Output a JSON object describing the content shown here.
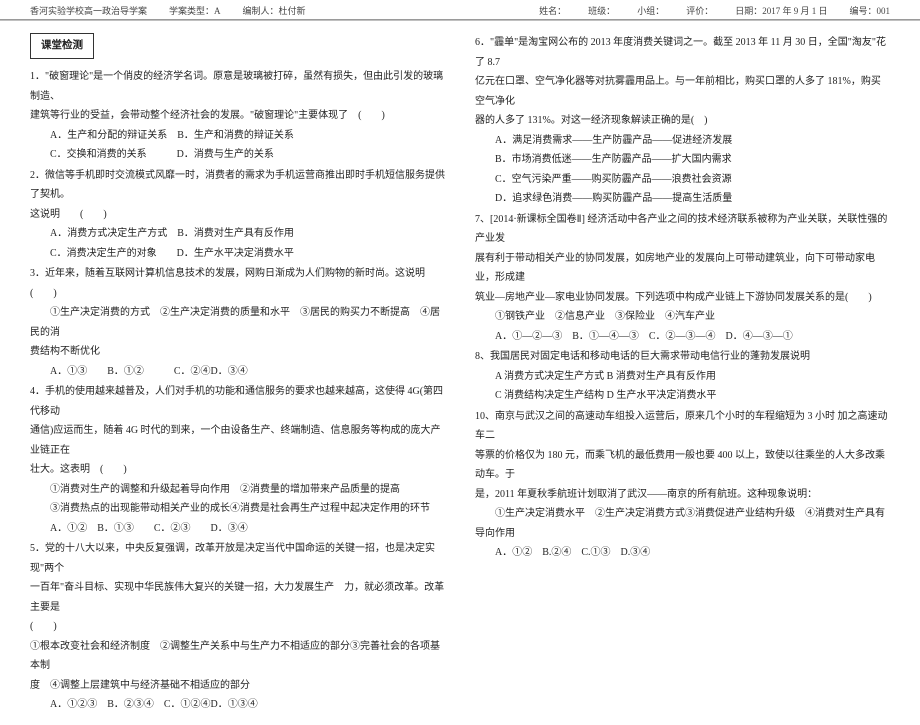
{
  "header": {
    "school": "香河实验学校高一政治导学案",
    "type_label": "学案类型：A",
    "author": "编制人：杜付新",
    "name_label": "姓名：",
    "class_label": "班级：",
    "group_label": "小组：",
    "eval_label": "评价：",
    "date_label": "日期：2017 年 9 月 1 日",
    "id_label": "编号：001"
  },
  "section_title": "课堂检测",
  "left": {
    "q1_l1": "1．\"破窗理论\"是一个俏皮的经济学名词。原意是玻璃被打碎，虽然有损失，但由此引发的玻璃制造、",
    "q1_l2": "建筑等行业的受益，会带动整个经济社会的发展。\"破窗理论\"主要体现了　(　　)",
    "q1_opts": "A．生产和分配的辩证关系　B．生产和消费的辩证关系",
    "q1_opts2": "C．交换和消费的关系　　　D．消费与生产的关系",
    "q2_l1": "2．微信等手机即时交流模式风靡一时，消费者的需求为手机运营商推出即时手机短信服务提供了契机。",
    "q2_l2": "这说明　　(　　)",
    "q2_opts": "A．消费方式决定生产方式　B．消费对生产具有反作用",
    "q2_opts2": "C．消费决定生产的对象　　D．生产水平决定消费水平",
    "q3_l1": "3．近年来，随着互联网计算机信息技术的发展，网购日渐成为人们购物的新时尚。这说明　(　　)",
    "q3_items": "　　①生产决定消费的方式　②生产决定消费的质量和水平　③居民的购买力不断提高　④居民的消",
    "q3_items2": "费结构不断优化",
    "q3_opts": "A．①③　　B．①②　　　C．②④D．③④",
    "q4_l1": "4．手机的使用越来越普及，人们对手机的功能和通信服务的要求也越来越高，这使得 4G(第四代移动",
    "q4_l2": "通信)应运而生，随着 4G 时代的到来，一个由设备生产、终端制造、信息服务等构成的庞大产业链正在",
    "q4_l3": "壮大。这表明　(　　)",
    "q4_items1": "　　①消费对生产的调整和升级起着导向作用　②消费量的增加带来产品质量的提高",
    "q4_items2": "　　③消费热点的出现能带动相关产业的成长④消费是社会再生产过程中起决定作用的环节",
    "q4_opts": "A．①②　B．①③　　C．②③　　D．③④",
    "q5_l1": "5．党的十八大以来，中央反复强调，改革开放是决定当代中国命运的关键一招，也是决定实现\"两个",
    "q5_l2": "一百年\"奋斗目标、实现中华民族伟大复兴的关键一招，大力发展生产　力，就必须改革。改革主要是",
    "q5_l3": "(　　)",
    "q5_items": "①根本改变社会和经济制度　②调整生产关系中与生产力不相适应的部分③完善社会的各项基本制",
    "q5_items2": "度　④调整上层建筑中与经济基础不相适应的部分",
    "q5_opts": "A．①②③　B．②③④　C．①②④D．①③④"
  },
  "right": {
    "q6_l1": "6．\"霾单\"是淘宝网公布的 2013 年度消费关键词之一。截至 2013 年 11 月 30 日，全国\"淘友\"花了 8.7",
    "q6_l2": "亿元在口罩、空气净化器等对抗雾霾用品上。与一年前相比，购买口罩的人多了 181%，购买空气净化",
    "q6_l3": "器的人多了 131%。对这一经济现象解读正确的是(　)",
    "q6_a": "A．满足消费需求——生产防霾产品——促进经济发展",
    "q6_b": "B．市场消费低迷——生产防霾产品——扩大国内需求",
    "q6_c": "C．空气污染严重——购买防霾产品——浪费社会资源",
    "q6_d": "D．追求绿色消费——购买防霾产品——提高生活质量",
    "q7_l1": "7、[2014·新课标全国卷Ⅱ] 经济活动中各产业之间的技术经济联系被称为产业关联，关联性强的产业发",
    "q7_l2": "展有利于带动相关产业的协同发展，如房地产业的发展向上可带动建筑业，向下可带动家电业，形成建",
    "q7_l3": "筑业—房地产业—家电业协同发展。下列选项中构成产业链上下游协同发展关系的是(　　)",
    "q7_items": "　　①钢铁产业　②信息产业　③保险业　④汽车产业",
    "q7_opts": "A．①—②—③　B．①—④—③　C．②—③—④　D．④—③—①",
    "q8_l1": "8、我国居民对固定电话和移动电话的巨大需求带动电信行业的蓬勃发展说明",
    "q8_ab": "A 消费方式决定生产方式 B 消费对生产具有反作用",
    "q8_cd": "C 消费结构决定生产结构 D 生产水平决定消费水平",
    "q10_l1": "10、南京与武汉之间的高速动车组投入运营后，原来几个小时的车程缩短为 3 小时 加之高速动车二",
    "q10_l2": "等票的价格仅为 180 元，而乘飞机的最低费用一般也要 400 以上，致使以往乘坐的人大多改乘动车。于",
    "q10_l3": "是，2011 年夏秋季航班计划取消了武汉——南京的所有航班。这种现象说明：",
    "q10_items": "①生产决定消费水平　②生产决定消费方式③消费促进产业结构升级　④消费对生产具有导向作用",
    "q10_opts": "A．①②　B.②④　C.①③　D.③④"
  }
}
